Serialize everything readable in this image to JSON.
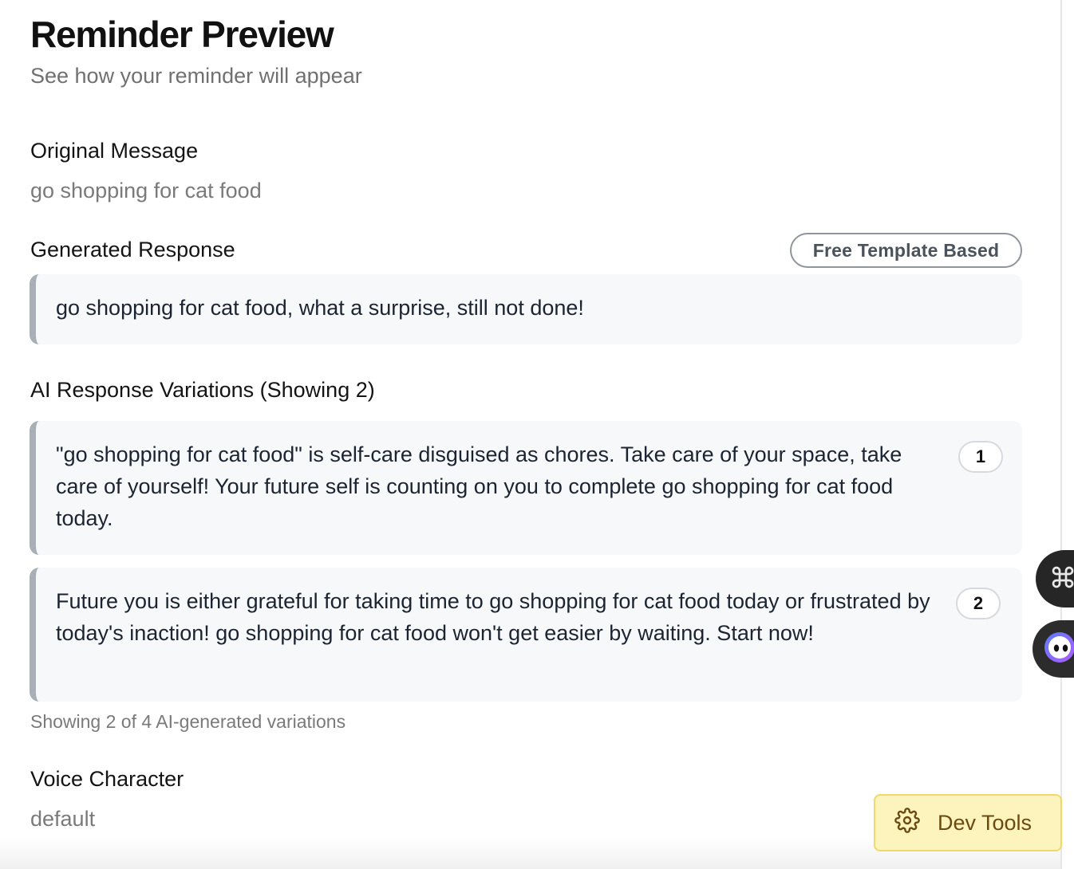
{
  "header": {
    "title": "Reminder Preview",
    "subtitle": "See how your reminder will appear"
  },
  "original": {
    "label": "Original Message",
    "value": "go shopping for cat food"
  },
  "generated": {
    "label": "Generated Response",
    "badge": "Free Template Based",
    "text": "go shopping for cat food, what a surprise, still not done!"
  },
  "variations": {
    "label": "AI Response Variations (Showing 2)",
    "items": [
      {
        "number": "1",
        "text": "\"go shopping for cat food\" is self-care disguised as chores. Take care of your space, take care of yourself! Your future self is counting on you to complete go shopping for cat food today."
      },
      {
        "number": "2",
        "text": "Future you is either grateful for taking time to go shopping for cat food today or frustrated by today's inaction! go shopping for cat food won't get easier by waiting. Start now!"
      }
    ],
    "caption": "Showing 2 of 4 AI-generated variations"
  },
  "voice": {
    "label": "Voice Character",
    "value": "default"
  },
  "dev_tools": {
    "label": "Dev Tools",
    "icon": "gear-icon"
  },
  "floating": {
    "command_icon": "command-icon",
    "assistant_icon": "assistant-eye-icon"
  },
  "colors": {
    "card_bg": "#f7f8fa",
    "card_border": "#a9afb7",
    "dev_tools_bg": "#fdf4bd",
    "dev_tools_text": "#6b4a12"
  }
}
